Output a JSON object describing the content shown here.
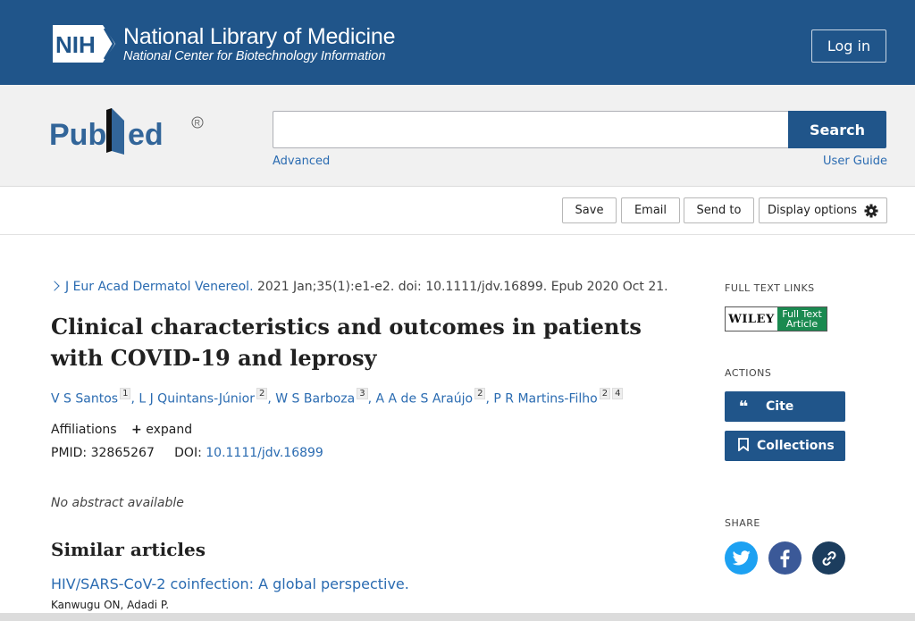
{
  "header": {
    "logo_text": "NIH",
    "title": "National Library of Medicine",
    "subtitle": "National Center for Biotechnology Information",
    "login_label": "Log in"
  },
  "search": {
    "brand": "PubMed",
    "placeholder": "",
    "value": "",
    "button_label": "Search",
    "advanced_label": "Advanced",
    "user_guide_label": "User Guide"
  },
  "toolbar": {
    "save_label": "Save",
    "email_label": "Email",
    "send_to_label": "Send to",
    "display_options_label": "Display options"
  },
  "article": {
    "journal": "J Eur Acad Dermatol Venereol.",
    "citation_rest": " 2021 Jan;35(1):e1-e2. doi: 10.1111/jdv.16899. Epub 2020 Oct 21.",
    "title": "Clinical characteristics and outcomes in patients with COVID-19 and leprosy",
    "authors": [
      {
        "name": "V S Santos",
        "sup": "1"
      },
      {
        "name": "L J Quintans-Júnior",
        "sup": "2"
      },
      {
        "name": "W S Barboza",
        "sup": "3"
      },
      {
        "name": "A A de S Araújo",
        "sup": "2"
      },
      {
        "name": "P R Martins-Filho",
        "sup": "2",
        "sup2": "4"
      }
    ],
    "affiliations_label": "Affiliations",
    "expand_label": "expand",
    "pmid_label": "PMID:",
    "pmid_value": "32865267",
    "doi_label": "DOI:",
    "doi_value": "10.1111/jdv.16899",
    "no_abstract": "No abstract available"
  },
  "similar": {
    "heading": "Similar articles",
    "items": [
      {
        "title": "HIV/SARS-CoV-2 coinfection: A global perspective.",
        "authors": "Kanwugu ON, Adadi P."
      }
    ]
  },
  "sidebar": {
    "full_text_heading": "FULL TEXT LINKS",
    "wiley_left": "WILEY",
    "wiley_right_1": "Full Text",
    "wiley_right_2": "Article",
    "actions_heading": "ACTIONS",
    "cite_label": "Cite",
    "collections_label": "Collections",
    "share_heading": "SHARE"
  },
  "colors": {
    "nih_blue": "#20558a",
    "link_blue": "#2a6bb1",
    "twitter": "#1da1f2",
    "facebook": "#3b5998",
    "link_share": "#1c3d5e"
  },
  "icons": [
    "nih-logo-icon",
    "gear-icon",
    "chevron-right-icon",
    "plus-icon",
    "quote-icon",
    "bookmark-icon",
    "twitter-icon",
    "facebook-icon",
    "link-icon"
  ]
}
